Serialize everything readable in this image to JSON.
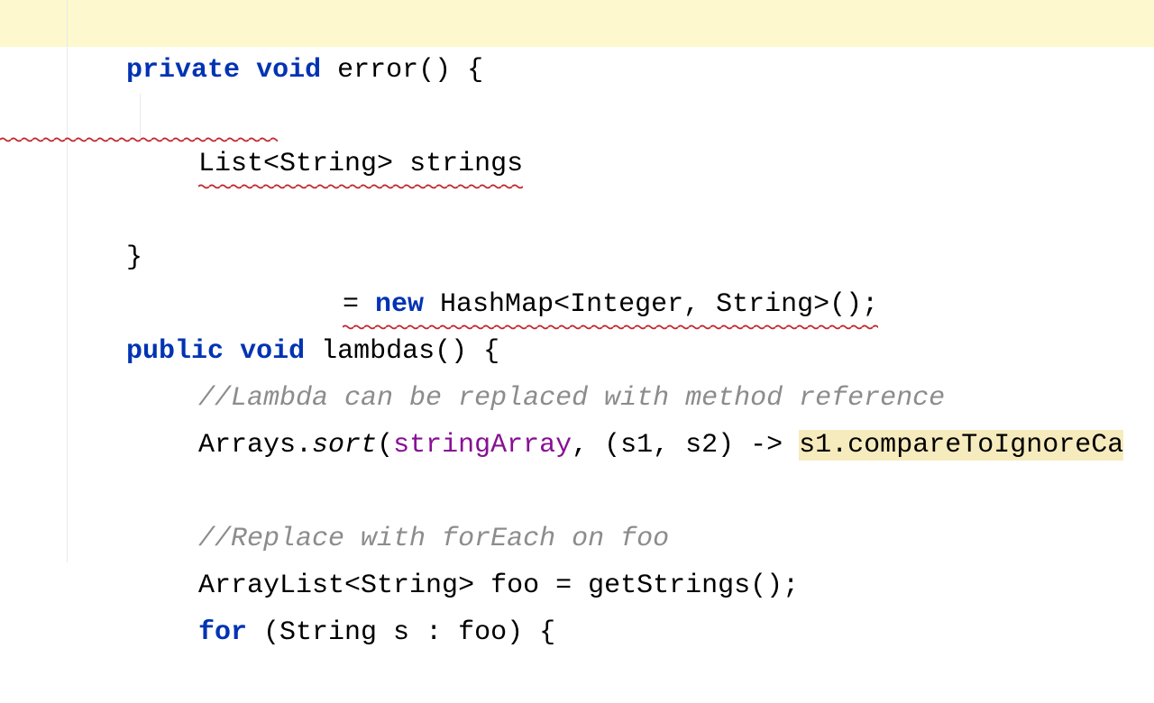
{
  "code": {
    "line1": {
      "kw_private": "private",
      "kw_void": "void",
      "method_name": "error",
      "parens_brace": "() {"
    },
    "line2": {
      "type": "List<String>",
      "varname": "strings"
    },
    "line3": {
      "equals": "= ",
      "kw_new": "new",
      "rest": " HashMap<Integer, String>();"
    },
    "line4": {
      "brace": "}"
    },
    "line6": {
      "kw_public": "public",
      "kw_void": "void",
      "method_name": "lambdas",
      "parens_brace": "() {"
    },
    "line7": {
      "comment": "//Lambda can be replaced with method reference"
    },
    "line8": {
      "arrays": "Arrays.",
      "sort": "sort",
      "open": "(",
      "field": "stringArray",
      "mid": ", (s1, s2) -> ",
      "highlight": "s1.compareToIgnoreCa"
    },
    "line10": {
      "comment": "//Replace with forEach on foo"
    },
    "line11": {
      "text": "ArrayList<String> foo = getStrings();"
    },
    "line12": {
      "kw_for": "for",
      "rest": " (String s : foo) {"
    }
  }
}
